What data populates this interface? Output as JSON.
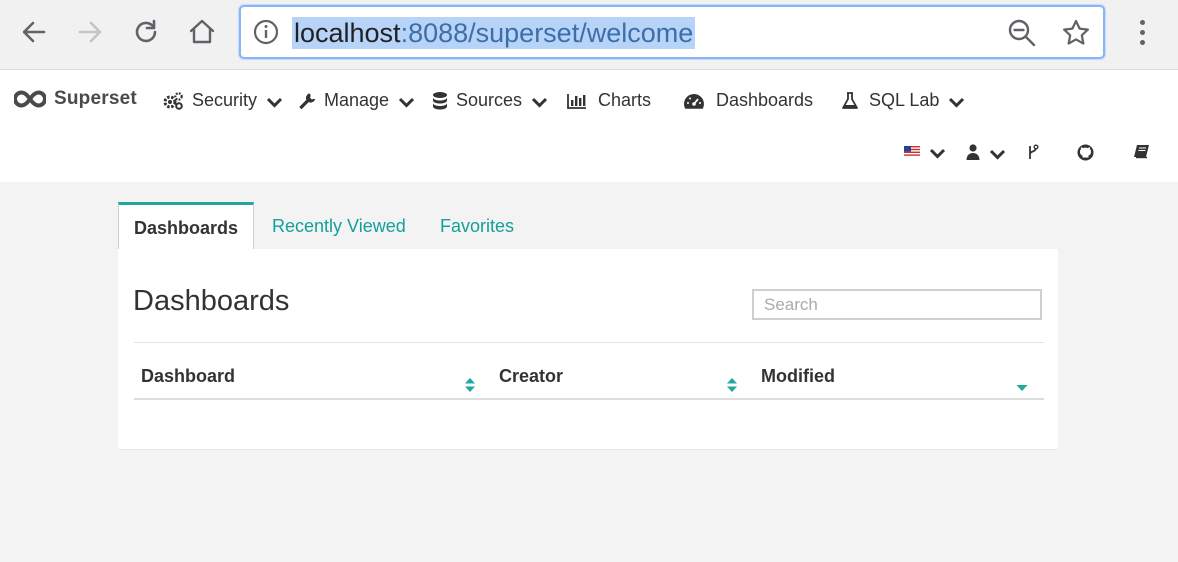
{
  "browser": {
    "url_host": "localhost",
    "url_rest": ":8088/superset/welcome"
  },
  "icons": {
    "back": "arrow-left-icon",
    "forward": "arrow-right-icon",
    "reload": "reload-icon",
    "home": "home-icon",
    "site_info": "info-icon",
    "zoom": "zoom-out-icon",
    "bookmark": "star-icon",
    "menu": "kebab-menu-icon"
  },
  "navbar": {
    "brand": "Superset",
    "menus": {
      "security": "Security",
      "manage": "Manage",
      "sources": "Sources",
      "charts": "Charts",
      "dashboards": "Dashboards",
      "sql_lab": "SQL Lab"
    }
  },
  "tabs": {
    "dashboards": "Dashboards",
    "recently_viewed": "Recently Viewed",
    "favorites": "Favorites"
  },
  "panel": {
    "title": "Dashboards",
    "search_placeholder": "Search",
    "columns": {
      "dashboard": "Dashboard",
      "creator": "Creator",
      "modified": "Modified"
    },
    "rows": []
  },
  "colors": {
    "accent": "#20a7a0",
    "link": "#14a09a",
    "url_highlight": "#b7d3f8",
    "omnibox_focus": "#8ab4f8"
  }
}
